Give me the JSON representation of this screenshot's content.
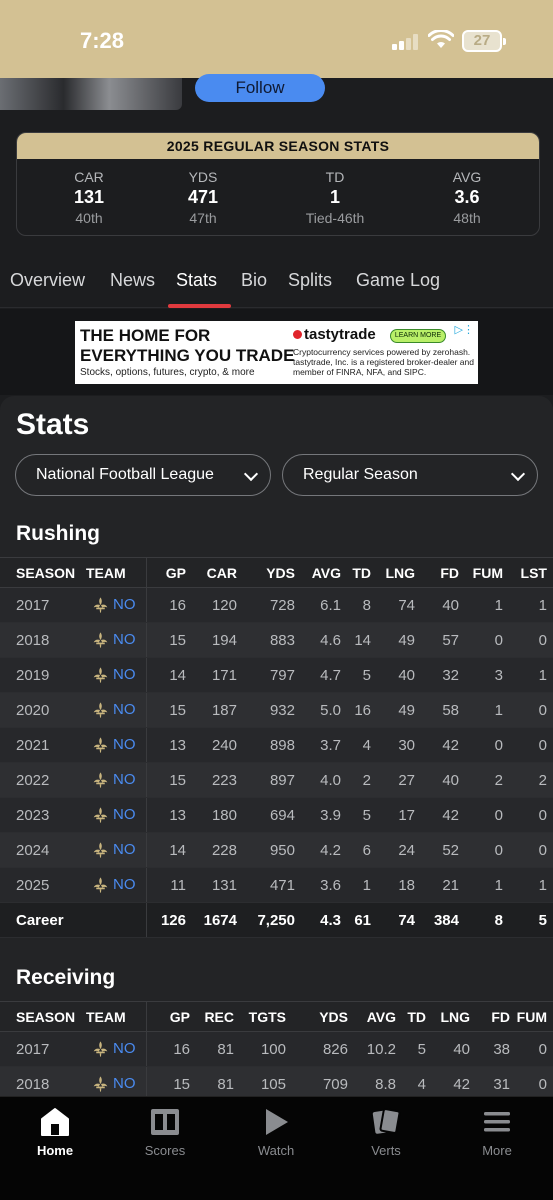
{
  "status": {
    "time": "7:28",
    "battery": "27"
  },
  "header": {
    "follow_label": "Follow"
  },
  "season_stats": {
    "title": "2025 REGULAR SEASON STATS",
    "items": [
      {
        "label": "CAR",
        "value": "131",
        "rank": "40th"
      },
      {
        "label": "YDS",
        "value": "471",
        "rank": "47th"
      },
      {
        "label": "TD",
        "value": "1",
        "rank": "Tied-46th"
      },
      {
        "label": "AVG",
        "value": "3.6",
        "rank": "48th"
      }
    ]
  },
  "tabs": [
    "Overview",
    "News",
    "Stats",
    "Bio",
    "Splits",
    "Game Log"
  ],
  "active_tab": "Stats",
  "ad": {
    "headline1": "THE HOME FOR",
    "headline2": "EVERYTHING YOU TRADE",
    "sub": "Stocks, options, futures, crypto, & more",
    "brand": "tastytrade",
    "cta": "LEARN MORE",
    "disclaimer": "Cryptocurrency services powered by zerohash. tastytrade, Inc. is a registered broker-dealer and member of FINRA, NFA, and SIPC."
  },
  "stats": {
    "title": "Stats",
    "league_select": "National Football League",
    "season_select": "Regular Season"
  },
  "rushing": {
    "title": "Rushing",
    "columns": [
      "SEASON",
      "TEAM",
      "GP",
      "CAR",
      "YDS",
      "AVG",
      "TD",
      "LNG",
      "FD",
      "FUM",
      "LST"
    ],
    "rows": [
      [
        "2017",
        "NO",
        "16",
        "120",
        "728",
        "6.1",
        "8",
        "74",
        "40",
        "1",
        "1"
      ],
      [
        "2018",
        "NO",
        "15",
        "194",
        "883",
        "4.6",
        "14",
        "49",
        "57",
        "0",
        "0"
      ],
      [
        "2019",
        "NO",
        "14",
        "171",
        "797",
        "4.7",
        "5",
        "40",
        "32",
        "3",
        "1"
      ],
      [
        "2020",
        "NO",
        "15",
        "187",
        "932",
        "5.0",
        "16",
        "49",
        "58",
        "1",
        "0"
      ],
      [
        "2021",
        "NO",
        "13",
        "240",
        "898",
        "3.7",
        "4",
        "30",
        "42",
        "0",
        "0"
      ],
      [
        "2022",
        "NO",
        "15",
        "223",
        "897",
        "4.0",
        "2",
        "27",
        "40",
        "2",
        "2"
      ],
      [
        "2023",
        "NO",
        "13",
        "180",
        "694",
        "3.9",
        "5",
        "17",
        "42",
        "0",
        "0"
      ],
      [
        "2024",
        "NO",
        "14",
        "228",
        "950",
        "4.2",
        "6",
        "24",
        "52",
        "0",
        "0"
      ],
      [
        "2025",
        "NO",
        "11",
        "131",
        "471",
        "3.6",
        "1",
        "18",
        "21",
        "1",
        "1"
      ]
    ],
    "career": [
      "Career",
      "",
      "126",
      "1674",
      "7,250",
      "4.3",
      "61",
      "74",
      "384",
      "8",
      "5"
    ]
  },
  "receiving": {
    "title": "Receiving",
    "columns": [
      "SEASON",
      "TEAM",
      "GP",
      "REC",
      "TGTS",
      "YDS",
      "AVG",
      "TD",
      "LNG",
      "FD",
      "FUM"
    ],
    "rows": [
      [
        "2017",
        "NO",
        "16",
        "81",
        "100",
        "826",
        "10.2",
        "5",
        "40",
        "38",
        "0"
      ],
      [
        "2018",
        "NO",
        "15",
        "81",
        "105",
        "709",
        "8.8",
        "4",
        "42",
        "31",
        "0"
      ]
    ]
  },
  "bottom_nav": [
    {
      "label": "Home",
      "icon": "home-icon",
      "active": true
    },
    {
      "label": "Scores",
      "icon": "scoreboard-icon",
      "active": false
    },
    {
      "label": "Watch",
      "icon": "play-icon",
      "active": false
    },
    {
      "label": "Verts",
      "icon": "cards-icon",
      "active": false
    },
    {
      "label": "More",
      "icon": "menu-icon",
      "active": false
    }
  ],
  "colors": {
    "gold": "#d3c193",
    "accent_red": "#e03a3e",
    "link_blue": "#4a8bf0"
  }
}
